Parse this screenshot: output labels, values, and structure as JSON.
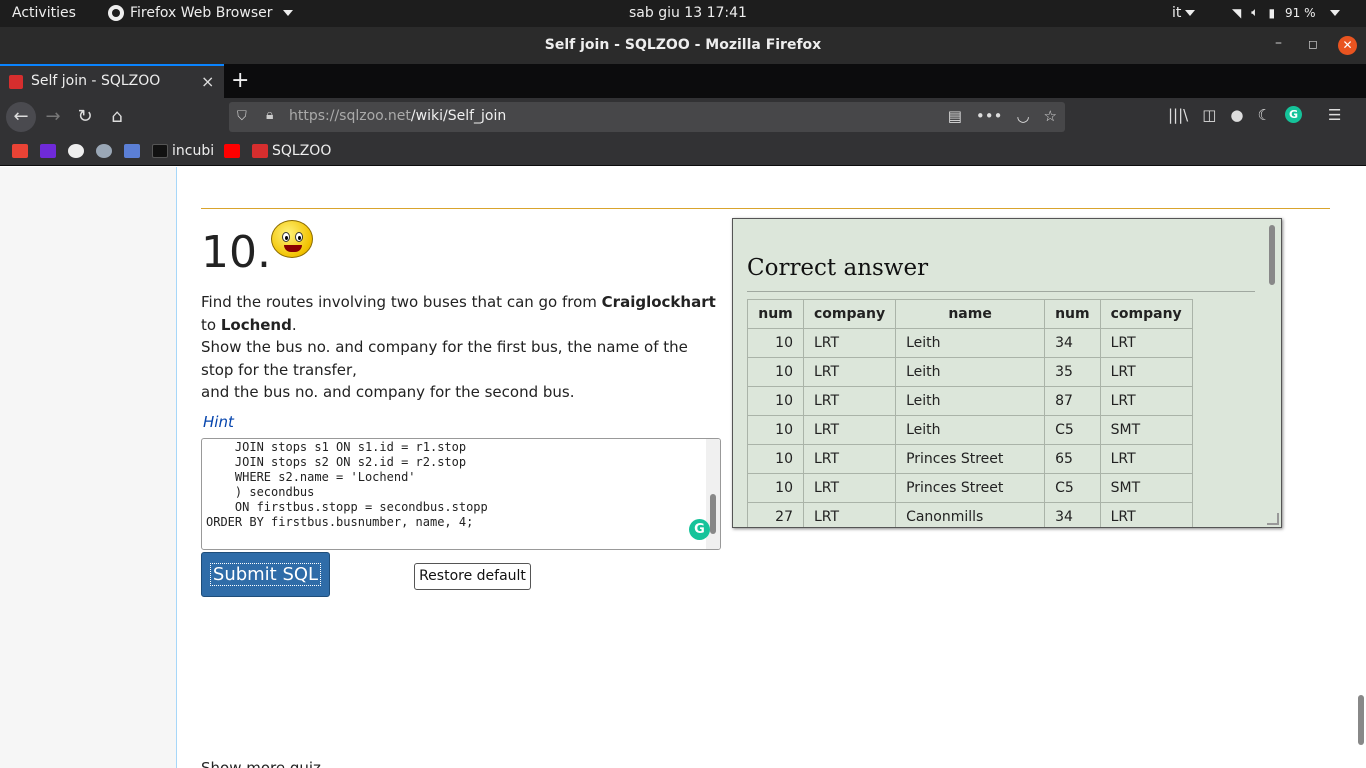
{
  "system_bar": {
    "activities": "Activities",
    "app_name": "Firefox Web Browser",
    "clock": "sab giu 13  17:41",
    "language": "it",
    "battery": "91 %"
  },
  "window": {
    "title": "Self join - SQLZOO - Mozilla Firefox"
  },
  "tab": {
    "label": "Self join - SQLZOO",
    "close": "×",
    "new_tab": "+"
  },
  "navbar": {
    "url_host": "https://sqlzoo.net",
    "url_path": "/wiki/Self_join"
  },
  "bookmarks": {
    "incubi": "incubi",
    "sqlzoo": "SQLZOO"
  },
  "question": {
    "number": "10.",
    "text_1": "Find the routes involving two buses that can go from ",
    "stop_from": "Craiglockhart",
    "text_2": " to ",
    "stop_to": "Lochend",
    "text_3": ".",
    "line_2": "Show the bus no. and company for the first bus, the name of the stop for the transfer,",
    "line_3": "and the bus no. and company for the second bus.",
    "hint": "Hint"
  },
  "editor": {
    "sql": "    JOIN stops s1 ON s1.id = r1.stop\n    JOIN stops s2 ON s2.id = r2.stop\n    WHERE s2.name = 'Lochend'\n    ) secondbus\n    ON firstbus.stopp = secondbus.stopp\nORDER BY firstbus.busnumber, name, 4;",
    "submit_label": "Submit SQL",
    "restore_label": "Restore default"
  },
  "answer": {
    "heading": "Correct answer",
    "columns": [
      "num",
      "company",
      "name",
      "num",
      "company"
    ],
    "rows": [
      [
        "10",
        "LRT",
        "Leith",
        "34",
        "LRT"
      ],
      [
        "10",
        "LRT",
        "Leith",
        "35",
        "LRT"
      ],
      [
        "10",
        "LRT",
        "Leith",
        "87",
        "LRT"
      ],
      [
        "10",
        "LRT",
        "Leith",
        "C5",
        "SMT"
      ],
      [
        "10",
        "LRT",
        "Princes Street",
        "65",
        "LRT"
      ],
      [
        "10",
        "LRT",
        "Princes Street",
        "C5",
        "SMT"
      ],
      [
        "27",
        "LRT",
        "Canonmills",
        "34",
        "LRT"
      ]
    ]
  },
  "footer": {
    "partial_text": "Show more quiz..."
  }
}
